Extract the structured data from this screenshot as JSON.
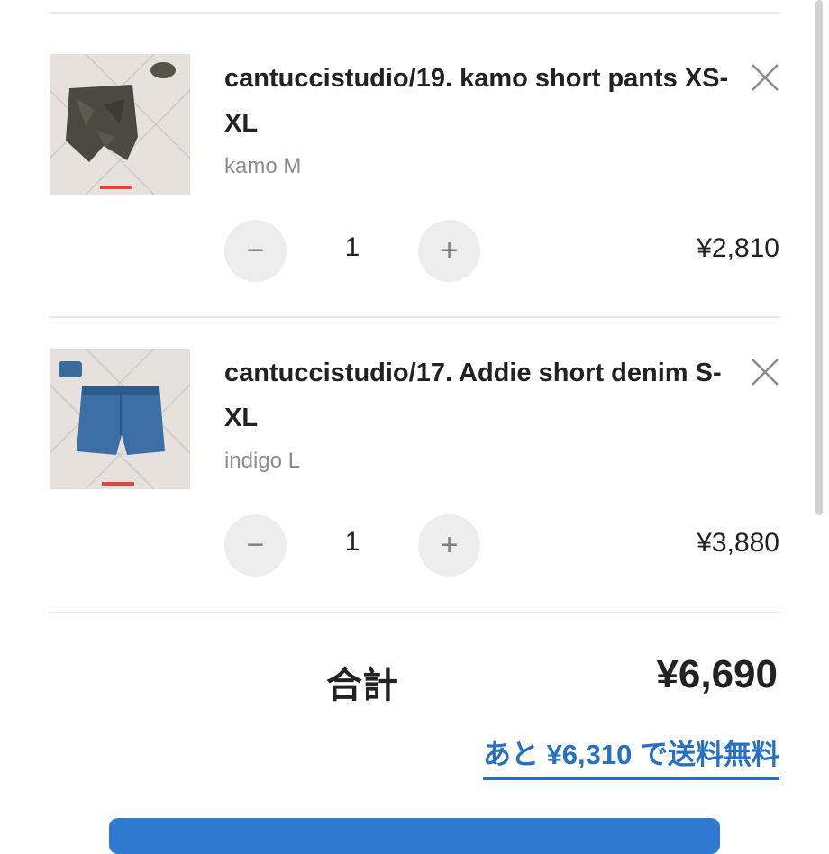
{
  "cart": {
    "items": [
      {
        "name": "cantuccistudio/19. kamo short pants XS-XL",
        "variant": "kamo M",
        "quantity": "1",
        "price": "¥2,810",
        "minus_glyph": "−",
        "plus_glyph": "+"
      },
      {
        "name": "cantuccistudio/17. Addie short denim S-XL",
        "variant": "indigo L",
        "quantity": "1",
        "price": "¥3,880",
        "minus_glyph": "−",
        "plus_glyph": "+"
      }
    ],
    "remove_icon": "close-icon"
  },
  "summary": {
    "total_label": "合計",
    "total_value": "¥6,690",
    "free_shipping_text": "あと ¥6,310 で送料無料"
  },
  "colors": {
    "accent": "#2870c0",
    "button_primary": "#2f7ad0",
    "qty_button_bg": "#ededed",
    "muted_text": "#8c8c8c"
  }
}
